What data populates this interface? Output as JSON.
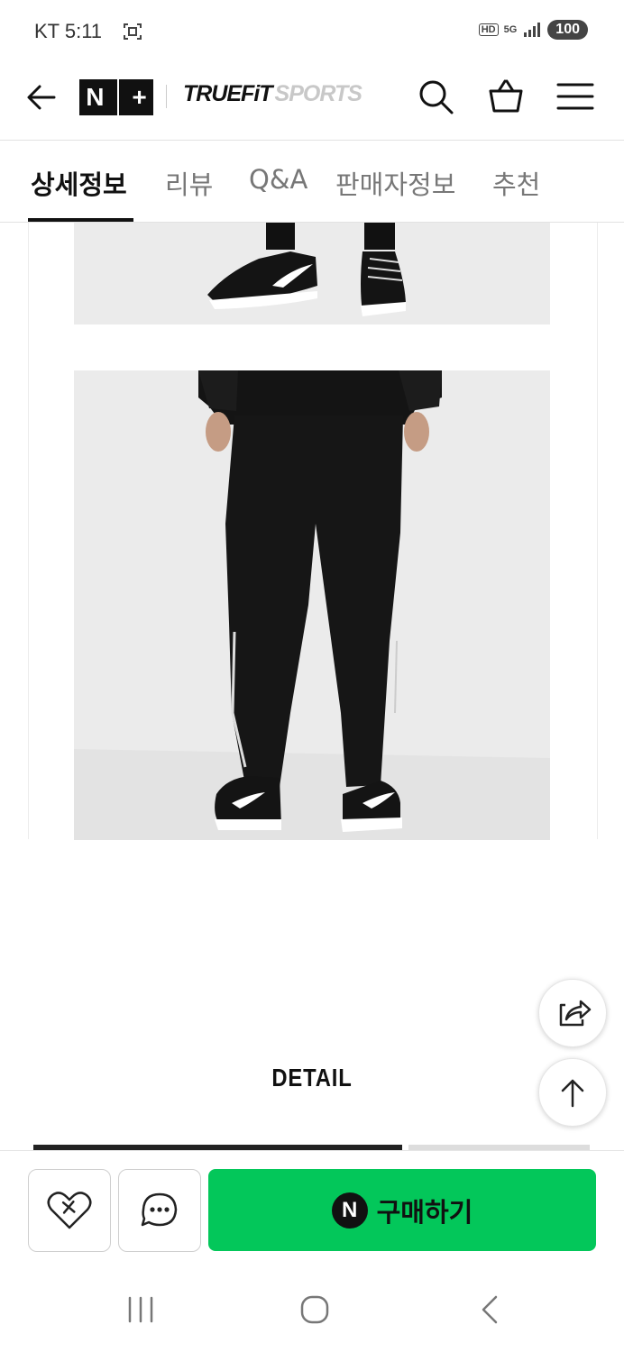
{
  "status": {
    "carrier": "KT",
    "time": "5:11",
    "hd": "HD",
    "network": "5G",
    "battery": "100"
  },
  "header": {
    "logo_left": "N",
    "logo_right": "+",
    "brand_primary": "TRUEFiT",
    "brand_secondary": "SPORTS"
  },
  "tabs": [
    {
      "label": "상세정보",
      "active": true
    },
    {
      "label": "리뷰",
      "active": false
    },
    {
      "label": "Q&A",
      "active": false
    },
    {
      "label": "판매자정보",
      "active": false
    },
    {
      "label": "추천",
      "active": false
    }
  ],
  "content": {
    "section_title": "DETAIL"
  },
  "bottom": {
    "buy_logo": "N",
    "buy_label": "구매하기"
  },
  "colors": {
    "buy_green": "#03c75a",
    "text_dark": "#111111"
  }
}
